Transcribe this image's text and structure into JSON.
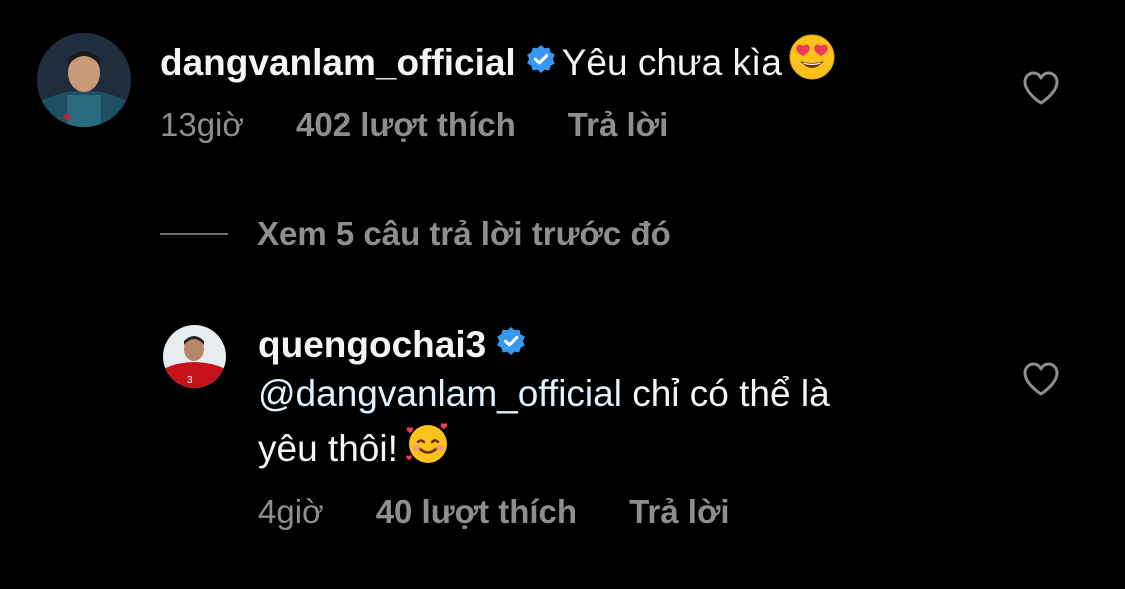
{
  "comment": {
    "username": "dangvanlam_official",
    "text": "Yêu chưa kìa",
    "emoji": "heart-eyes-emoji",
    "time": "13giờ",
    "likes": "402 lượt thích",
    "reply": "Trả lời",
    "verified": true
  },
  "view_replies": {
    "label": "Xem 5 câu trả lời trước đó"
  },
  "reply": {
    "username": "quengochai3",
    "mention": "@dangvanlam_official",
    "text_part1": " chỉ có thể là",
    "text_part2": "yêu thôi!",
    "emoji": "smiling-face-with-hearts-emoji",
    "time": "4giờ",
    "likes": "40 lượt thích",
    "reply": "Trả lời",
    "verified": true
  },
  "colors": {
    "background": "#000000",
    "text": "#f5f5f5",
    "secondary": "#8e8e8e",
    "verified": "#3897f0"
  }
}
